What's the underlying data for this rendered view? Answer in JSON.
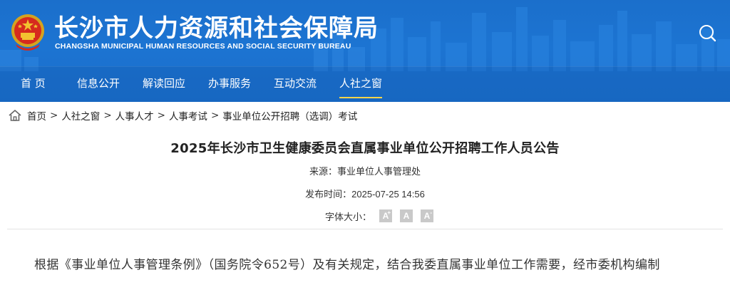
{
  "header": {
    "title": "长沙市人力资源和社会保障局",
    "subtitle": "CHANGSHA MUNICIPAL HUMAN RESOURCES AND SOCIAL SECURITY BUREAU",
    "search_icon": "search-icon",
    "emblem_icon": "national-emblem-icon"
  },
  "nav": {
    "items": [
      {
        "label": "首 页"
      },
      {
        "label": "信息公开"
      },
      {
        "label": "解读回应"
      },
      {
        "label": "办事服务"
      },
      {
        "label": "互动交流"
      },
      {
        "label": "人社之窗"
      }
    ],
    "active_index": 5
  },
  "breadcrumb": {
    "home_icon": "home-icon",
    "items": [
      "首页",
      "人社之窗",
      "人事人才",
      "人事考试",
      "事业单位公开招聘（选调）考试"
    ],
    "separator": ">"
  },
  "article": {
    "title": "2025年长沙市卫生健康委员会直属事业单位公开招聘工作人员公告",
    "source_label": "来源：",
    "source_value": "事业单位人事管理处",
    "published_label": "发布时间：",
    "published_value": "2025-07-25 14:56",
    "font_size_label": "字体大小：",
    "font_buttons": [
      "A+",
      "A",
      "A-"
    ],
    "body_first_line": "根据《事业单位人事管理条例》（国务院令652号）及有关规定，结合我委直属事业单位工作需要，经市委机构编制"
  },
  "colors": {
    "header_blue": "#1c74d2",
    "active_underline": "#ffd54a",
    "font_button_gray": "#c9c9c9"
  }
}
